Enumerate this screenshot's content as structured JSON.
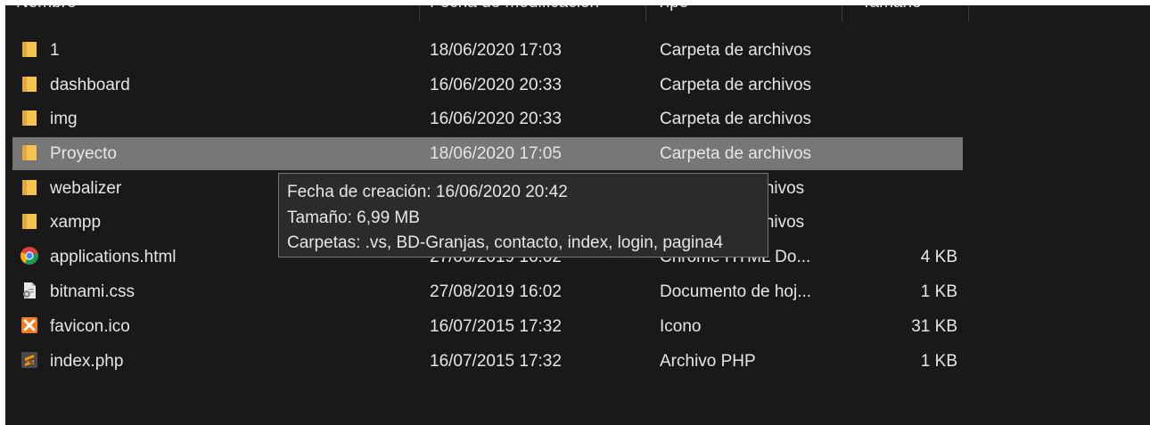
{
  "columns": [
    {
      "label": "Nombre"
    },
    {
      "label": "Fecha de modificación"
    },
    {
      "label": "Tipo"
    },
    {
      "label": "Tamaño"
    }
  ],
  "files": [
    {
      "name": "1",
      "date": "18/06/2020 17:03",
      "type": "Carpeta de archivos",
      "size": "",
      "icon": "folder-icon"
    },
    {
      "name": "dashboard",
      "date": "16/06/2020 20:33",
      "type": "Carpeta de archivos",
      "size": "",
      "icon": "folder-icon"
    },
    {
      "name": "img",
      "date": "16/06/2020 20:33",
      "type": "Carpeta de archivos",
      "size": "",
      "icon": "folder-icon"
    },
    {
      "name": "Proyecto",
      "date": "18/06/2020 17:05",
      "type": "Carpeta de archivos",
      "size": "",
      "icon": "folder-icon",
      "selected": true
    },
    {
      "name": "webalizer",
      "date": "",
      "type": "rchivos",
      "size": "",
      "icon": "folder-icon"
    },
    {
      "name": "xampp",
      "date": "",
      "type": "rchivos",
      "size": "",
      "icon": "folder-icon"
    },
    {
      "name": "applications.html",
      "date": "27/08/2019 16:02",
      "type": "Chrome HTML Do...",
      "size": "4 KB",
      "icon": "chrome-icon"
    },
    {
      "name": "bitnami.css",
      "date": "27/08/2019 16:02",
      "type": "Documento de hoj...",
      "size": "1 KB",
      "icon": "css-file-icon"
    },
    {
      "name": "favicon.ico",
      "date": "16/07/2015 17:32",
      "type": "Icono",
      "size": "31 KB",
      "icon": "xampp-icon"
    },
    {
      "name": "index.php",
      "date": "16/07/2015 17:32",
      "type": "Archivo PHP",
      "size": "1 KB",
      "icon": "sublime-icon"
    }
  ],
  "tooltip": {
    "line1": "Fecha de creación: 16/06/2020 20:42",
    "line2": "Tamaño: 6,99 MB",
    "line3": "Carpetas: .vs, BD-Granjas, contacto, index, login, pagina4"
  },
  "colors": {
    "background": "#191919",
    "selected_row": "#777777",
    "folder": "#f4c44e",
    "text": "#e6e6e6"
  }
}
